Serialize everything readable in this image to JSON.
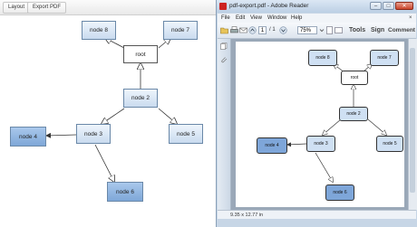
{
  "app": {
    "toolbar": {
      "layout_label": "Layout",
      "export_label": "Export PDF"
    },
    "nodes": {
      "node8": "node 8",
      "node7": "node 7",
      "root": "root",
      "node2": "node 2",
      "node3": "node 3",
      "node4": "node 4",
      "node5": "node 5",
      "node6": "node 6"
    }
  },
  "reader": {
    "title": "pdf-export.pdf - Adobe Reader",
    "window_buttons": {
      "minimize": "–",
      "maximize": "□",
      "close": "✕"
    },
    "menu": [
      "File",
      "Edit",
      "View",
      "Window",
      "Help"
    ],
    "menu_close": "×",
    "toolbar": {
      "page_current": "1",
      "page_total": "/ 1",
      "zoom": "75%",
      "tools_label": "Tools",
      "sign_label": "Sign",
      "comment_label": "Comment"
    },
    "page_size": "9.35 x 12.77 in",
    "nodes": {
      "node8": "node 8",
      "node7": "node 7",
      "root": "root",
      "node2": "node 2",
      "node3": "node 3",
      "node4": "node 4",
      "node5": "node 5",
      "node6": "node 6"
    }
  },
  "icons": {
    "open": "folder-icon",
    "print": "printer-icon",
    "email": "envelope-icon",
    "prev": "arrow-up-icon",
    "next": "arrow-down-icon",
    "pages_panel": "pages-icon",
    "attachments": "paperclip-icon"
  },
  "colors": {
    "node_light": "#c9dbef",
    "node_dark": "#7ea7d8",
    "reader_frame": "#c7d6e6",
    "close_button": "#c9452c"
  }
}
